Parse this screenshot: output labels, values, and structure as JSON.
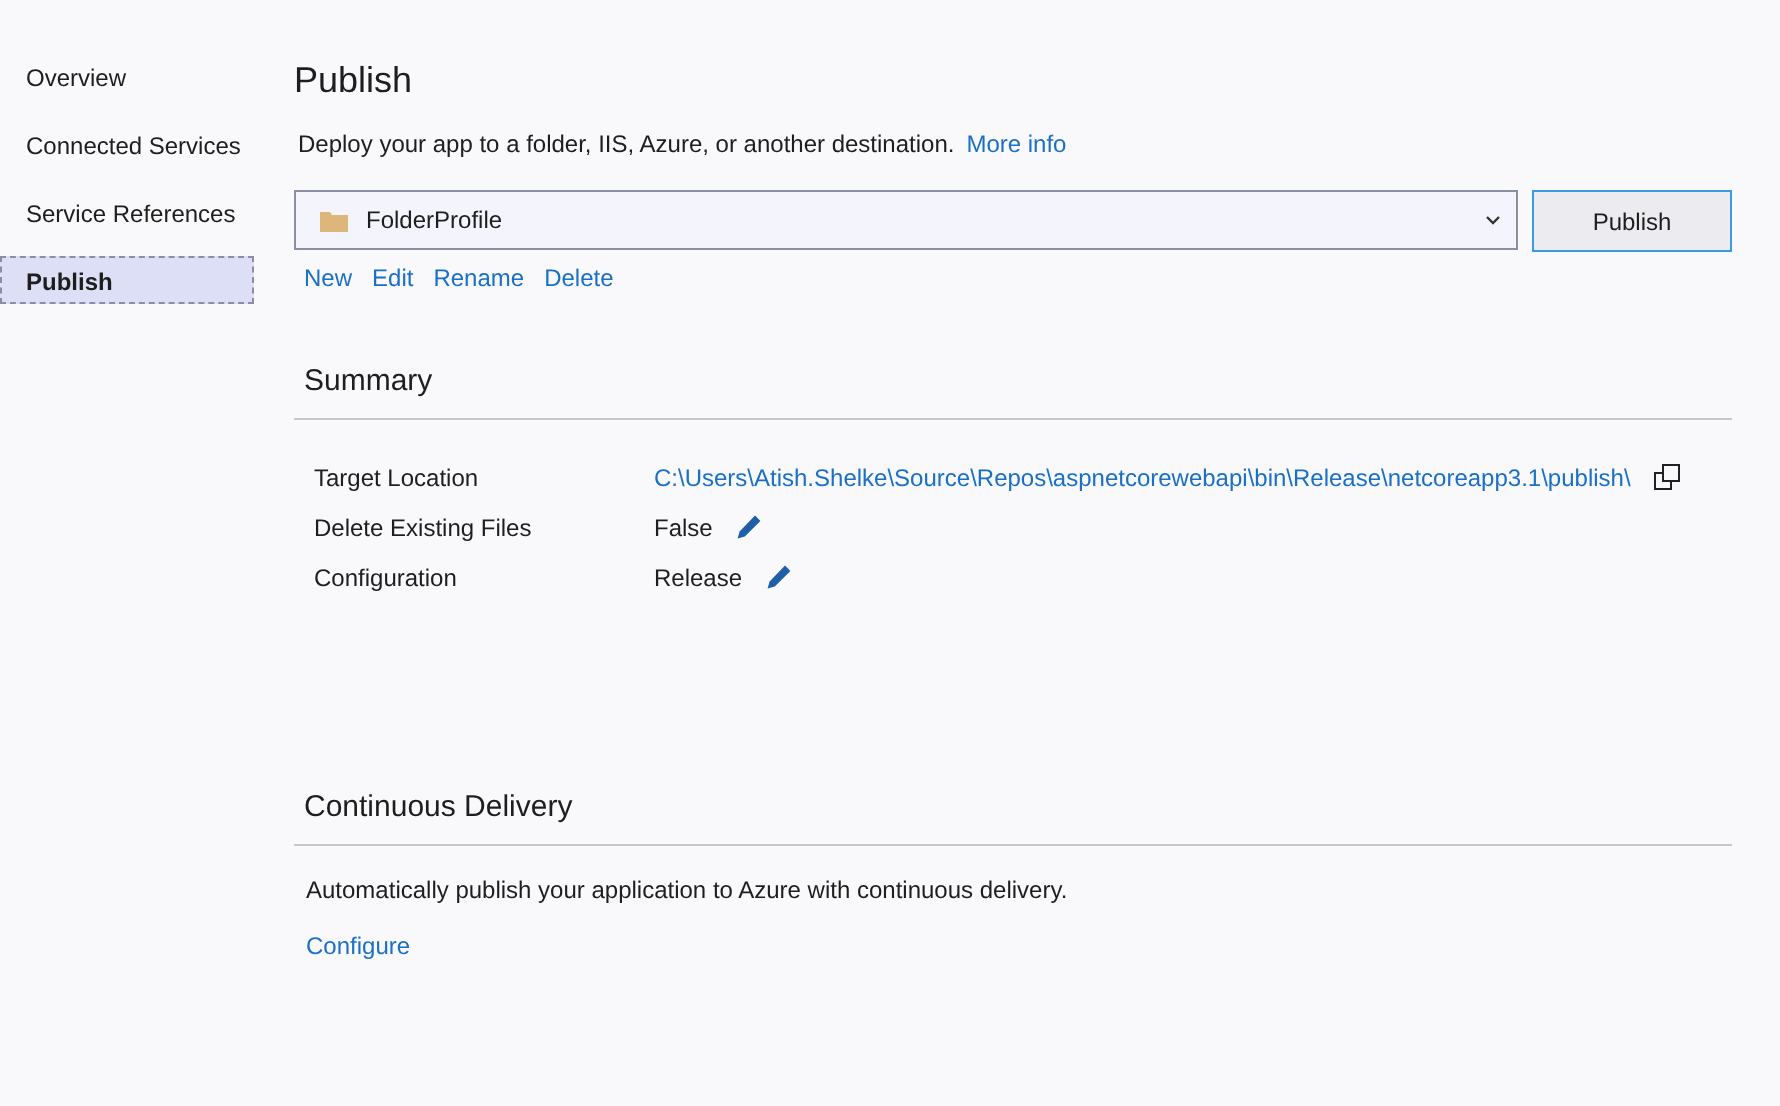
{
  "sidebar": {
    "items": [
      {
        "label": "Overview",
        "selected": false
      },
      {
        "label": "Connected Services",
        "selected": false
      },
      {
        "label": "Service References",
        "selected": false
      },
      {
        "label": "Publish",
        "selected": true
      }
    ]
  },
  "page": {
    "title": "Publish",
    "description": "Deploy your app to a folder, IIS, Azure, or another destination.",
    "more_info_link": "More info"
  },
  "profile": {
    "value": "FolderProfile",
    "publish_button": "Publish",
    "actions": [
      "New",
      "Edit",
      "Rename",
      "Delete"
    ]
  },
  "summary": {
    "heading": "Summary",
    "rows": [
      {
        "label": "Target Location",
        "value": "C:\\Users\\Atish.Shelke\\Source\\Repos\\aspnetcorewebapi\\bin\\Release\\netcoreapp3.1\\publish\\",
        "kind": "link"
      },
      {
        "label": "Delete Existing Files",
        "value": "False",
        "kind": "editable"
      },
      {
        "label": "Configuration",
        "value": "Release",
        "kind": "editable"
      }
    ]
  },
  "continuous_delivery": {
    "heading": "Continuous Delivery",
    "description": "Automatically publish your application to Azure with continuous delivery.",
    "configure_link": "Configure"
  }
}
